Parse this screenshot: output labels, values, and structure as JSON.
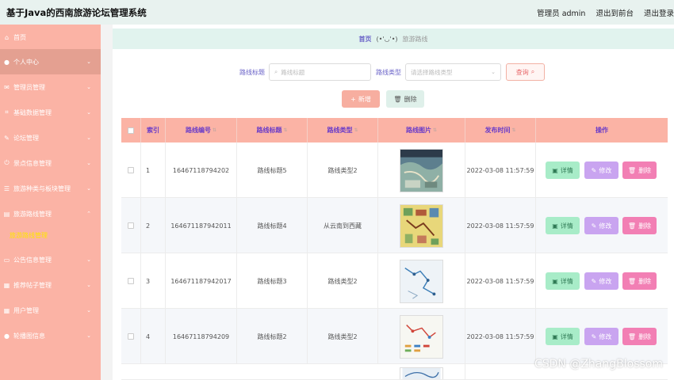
{
  "header": {
    "title": "基于Java的西南旅游论坛管理系统",
    "nav": [
      "管理员 admin",
      "退出到前台",
      "退出登录"
    ]
  },
  "sidebar": {
    "items": [
      {
        "label": "首页",
        "icon": "home-icon",
        "glyph": "⌂",
        "chevron": ""
      },
      {
        "label": "个人中心",
        "icon": "user-icon",
        "glyph": "👤",
        "chevron": "⌄"
      },
      {
        "label": "管理员管理",
        "icon": "mail-icon",
        "glyph": "✉",
        "chevron": "⌄"
      },
      {
        "label": "基础数据管理",
        "icon": "crop-icon",
        "glyph": "⌗",
        "chevron": "⌄"
      },
      {
        "label": "论坛管理",
        "icon": "edit-icon",
        "glyph": "✎",
        "chevron": "⌄"
      },
      {
        "label": "景点信息管理",
        "icon": "power-icon",
        "glyph": "⏻",
        "chevron": "⌄"
      },
      {
        "label": "旅游种类与板块管理",
        "icon": "list-icon",
        "glyph": "☰",
        "chevron": "⌄"
      },
      {
        "label": "旅游路线管理",
        "icon": "route-icon",
        "glyph": "▤",
        "chevron": "⌃"
      },
      {
        "label": "公告信息管理",
        "icon": "monitor-icon",
        "glyph": "▭",
        "chevron": "⌄"
      },
      {
        "label": "推荐帖子管理",
        "icon": "doc-icon",
        "glyph": "▦",
        "chevron": "⌄"
      },
      {
        "label": "用户管理",
        "icon": "grid-icon",
        "glyph": "▦",
        "chevron": "⌄"
      },
      {
        "label": "轮播图信息",
        "icon": "person-icon",
        "glyph": "👤",
        "chevron": "⌄"
      }
    ],
    "sub_item": "旅游路线管理"
  },
  "breadcrumb": {
    "home": "首页",
    "face": "(•'◡'•)",
    "current": "旅游路线"
  },
  "filters": {
    "title_label": "路线标题",
    "title_placeholder": "路线标题",
    "type_label": "路线类型",
    "type_placeholder": "请选择路线类型",
    "search_label": "查询"
  },
  "actions": {
    "add_label": "新增",
    "delete_label": "删除"
  },
  "table": {
    "columns": [
      "索引",
      "路线编号",
      "路线标题",
      "路线类型",
      "路线图片",
      "发布时间",
      "操作"
    ],
    "rows": [
      {
        "index": "1",
        "code": "16467118794202",
        "title": "路线标题5",
        "type": "路线类型2",
        "time": "2022-03-08 11:57:59"
      },
      {
        "index": "2",
        "code": "164671187942011",
        "title": "路线标题4",
        "type": "从云南到西藏",
        "time": "2022-03-08 11:57:59"
      },
      {
        "index": "3",
        "code": "164671187942017",
        "title": "路线标题3",
        "type": "路线类型2",
        "time": "2022-03-08 11:57:59"
      },
      {
        "index": "4",
        "code": "16467118794209",
        "title": "路线标题2",
        "type": "路线类型2",
        "time": "2022-03-08 11:57:59"
      }
    ],
    "row_actions": {
      "detail": "详情",
      "edit": "修改",
      "remove": "删除"
    }
  },
  "watermark": "CSDN @ZhangBlossom",
  "colors": {
    "accent": "#fbb3a5",
    "header_bg": "#e8f2ef",
    "link": "#6a63c8",
    "sub_active": "#ffe600"
  }
}
